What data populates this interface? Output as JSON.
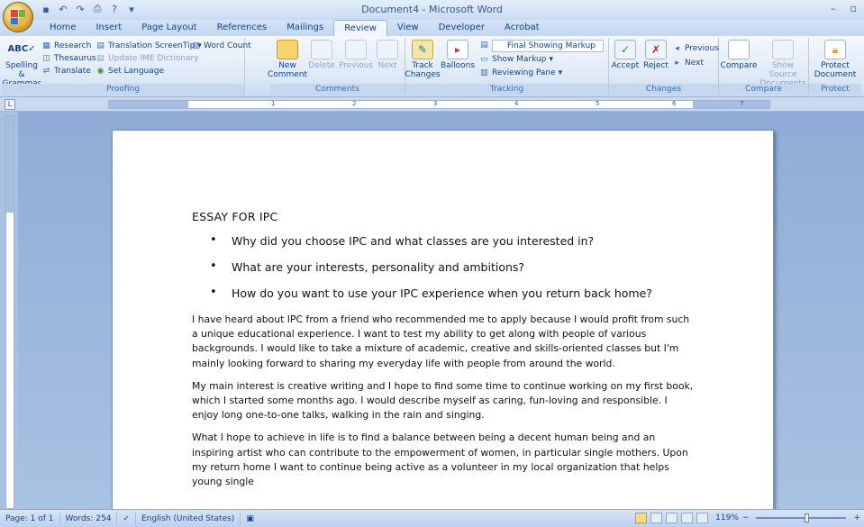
{
  "window": {
    "title": "Document4 - Microsoft Word",
    "minimize": "–",
    "maximize": "▫"
  },
  "quick_access": [
    {
      "name": "save-icon",
      "glyph": "▪"
    },
    {
      "name": "undo-icon",
      "glyph": "↶"
    },
    {
      "name": "redo-icon",
      "glyph": "↷"
    },
    {
      "name": "print-icon",
      "glyph": "⎙"
    },
    {
      "name": "help-icon",
      "glyph": "?"
    },
    {
      "name": "customize-icon",
      "glyph": "▾"
    }
  ],
  "tabs": [
    "Home",
    "Insert",
    "Page Layout",
    "References",
    "Mailings",
    "Review",
    "View",
    "Developer",
    "Acrobat"
  ],
  "active_tab": "Review",
  "ribbon": {
    "proofing": {
      "label": "Proofing",
      "spelling": "Spelling &\nGrammar",
      "research": "Research",
      "thesaurus": "Thesaurus",
      "translate": "Translate",
      "translation_screentip": "Translation ScreenTip",
      "update_ime": "Update IME Dictionary",
      "set_language": "Set Language",
      "word_count": "Word Count"
    },
    "comments": {
      "label": "Comments",
      "new": "New\nComment",
      "delete": "Delete",
      "previous": "Previous",
      "next": "Next"
    },
    "tracking": {
      "label": "Tracking",
      "track_changes": "Track\nChanges",
      "balloons": "Balloons",
      "final_showing_markup": "Final Showing Markup",
      "show_markup": "Show Markup",
      "reviewing_pane": "Reviewing Pane"
    },
    "changes": {
      "label": "Changes",
      "accept": "Accept",
      "reject": "Reject",
      "previous": "Previous",
      "next": "Next"
    },
    "compare": {
      "label": "Compare",
      "compare": "Compare",
      "show_source": "Show Source\nDocuments"
    },
    "protect": {
      "label": "Protect",
      "protect_document": "Protect\nDocument"
    }
  },
  "ruler": {
    "numbers": [
      "1",
      "2",
      "3",
      "4",
      "5",
      "6",
      "7"
    ]
  },
  "document": {
    "heading": "ESSAY FOR IPC",
    "bullets": [
      "Why did you choose IPC and what classes are you interested in?",
      "What are your interests, personality and ambitions?",
      "How do you want to use your IPC experience when you return back home?"
    ],
    "paragraphs": [
      "I have heard about IPC from a friend who recommended me to apply because I would profit from such a unique educational experience. I want to test my ability to get along with people of various backgrounds. I would like to take a mixture of academic, creative and skills-oriented classes but I'm mainly looking forward to sharing my everyday life with people from around the world.",
      "My main interest is creative writing and I hope to find some time to continue working on my first book, which I started some months ago. I would describe myself as caring, fun-loving and responsible. I enjoy long one-to-one talks, walking in the rain and singing.",
      "What I hope to achieve in life is to find a balance between being a decent human being and an inspiring artist who can contribute to the empowerment of women, in particular single mothers. Upon my return home I want to continue being active as a volunteer in my local organization that helps young single"
    ]
  },
  "status": {
    "page": "Page: 1 of 1",
    "words": "Words: 254",
    "language": "English (United States)",
    "zoom": "119%",
    "zoom_minus": "−",
    "zoom_plus": "+"
  },
  "colors": {
    "ribbon_text": "#15428b",
    "workspace": "#8eacd6",
    "page": "#ffffff"
  }
}
